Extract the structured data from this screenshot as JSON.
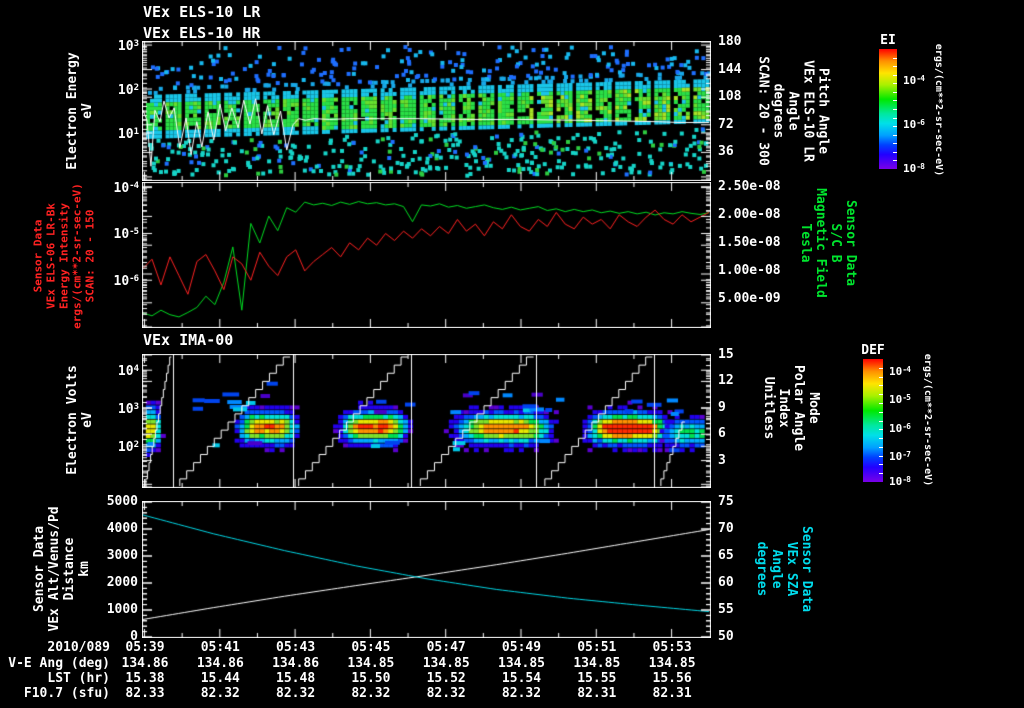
{
  "header": {
    "title_line1": "VEx ELS-10 LR",
    "title_line2": "VEx ELS-10 HR"
  },
  "colors": {
    "background": "#000000",
    "axis": "#ffffff",
    "red_series": "#ff2222",
    "green_series": "#00dd22",
    "cyan_series": "#00d9e8",
    "white_series": "#ffffff",
    "red_label": "#ff2222",
    "green_label": "#00e52e",
    "cyan_label": "#00dcec"
  },
  "chart_data": [
    {
      "type": "heatmap",
      "id": "els_pitch_angle_spectrogram",
      "left_label": "Electron Energy\neV",
      "right_label": "Pitch Angle\nVEx ELS-10 LR\nAngle\ndegrees\nSCAN: 20 - 300",
      "yaxis": {
        "scale": "log",
        "ticks": [
          "10^3",
          "10^2",
          "10^1"
        ],
        "tick_exps": [
          3,
          2,
          1
        ],
        "exp_top": 3.07,
        "exp_bottom": -0.07
      },
      "y2axis": {
        "min": 0,
        "max": 180,
        "ticks": [
          180,
          144,
          108,
          72,
          36
        ],
        "minor_step": 6
      },
      "band": {
        "logE_top_left": 1.86,
        "logE_top_right": 2.25,
        "logE_bottom_left": 0.95,
        "logE_bottom_right": 1.25
      },
      "pitch_line_deg": [
        [
          0,
          91
        ],
        [
          0.007,
          78
        ],
        [
          0.014,
          18
        ],
        [
          0.021,
          91
        ],
        [
          0.03,
          76
        ],
        [
          0.037,
          103
        ],
        [
          0.046,
          81
        ],
        [
          0.055,
          94
        ],
        [
          0.065,
          42
        ],
        [
          0.076,
          81
        ],
        [
          0.085,
          33
        ],
        [
          0.095,
          76
        ],
        [
          0.104,
          43
        ],
        [
          0.115,
          89
        ],
        [
          0.125,
          52
        ],
        [
          0.136,
          99
        ],
        [
          0.146,
          64
        ],
        [
          0.157,
          94
        ],
        [
          0.168,
          68
        ],
        [
          0.178,
          104
        ],
        [
          0.189,
          73
        ],
        [
          0.199,
          106
        ],
        [
          0.21,
          60
        ],
        [
          0.22,
          97
        ],
        [
          0.231,
          59
        ],
        [
          0.243,
          90
        ],
        [
          0.254,
          39
        ],
        [
          0.265,
          72
        ],
        [
          0.275,
          80
        ],
        [
          0.287,
          78
        ],
        [
          0.302,
          80
        ],
        [
          0.33,
          79
        ],
        [
          0.365,
          80
        ],
        [
          0.418,
          80
        ],
        [
          0.488,
          80
        ],
        [
          0.577,
          79
        ],
        [
          0.665,
          79
        ],
        [
          0.753,
          78
        ],
        [
          0.841,
          77
        ],
        [
          0.912,
          76
        ],
        [
          0.947,
          75
        ],
        [
          1,
          75
        ]
      ],
      "scatter": {
        "seed": 7,
        "n_above_band": 240,
        "n_below_band": 430,
        "n_blocks": 29
      }
    },
    {
      "type": "line",
      "id": "energy_intensity_and_bfield",
      "left_label": "Sensor Data\nVEx ELS-06 LR-Bk\nEnergy Intensity\nergs/(cm**2-sr-sec-eV)\nSCAN: 20 - 150",
      "right_label": "Sensor Data\nS/C B\nMagnetic Field\nTesla",
      "yaxis": {
        "scale": "log",
        "ticks": [
          "10^-4",
          "10^-5",
          "10^-6"
        ],
        "tick_exps": [
          -4,
          -5,
          -6
        ],
        "exp_top": -3.92,
        "exp_bottom": -7.0
      },
      "y2axis": {
        "min": 0,
        "max": 2.5e-08,
        "ticks": [
          "2.50e-08",
          "2.00e-08",
          "1.50e-08",
          "1.00e-08",
          "5.00e-09"
        ],
        "tick_values_nT": [
          25,
          20,
          15,
          10,
          5
        ]
      },
      "series": [
        {
          "name": "ELS energy intensity",
          "color": "#ff2222",
          "units": "log10 ergs/(cm**2-sr-sec-eV)",
          "values_log10": [
            -5.75,
            -5.55,
            -6.1,
            -5.5,
            -5.9,
            -6.3,
            -5.6,
            -5.45,
            -5.8,
            -6.2,
            -5.5,
            -5.65,
            -6.0,
            -5.4,
            -5.7,
            -5.9,
            -5.5,
            -5.35,
            -5.8,
            -5.6,
            -5.45,
            -5.3,
            -5.5,
            -5.2,
            -5.35,
            -5.1,
            -5.25,
            -5.0,
            -5.15,
            -4.95,
            -5.1,
            -4.9,
            -5.05,
            -4.85,
            -5.0,
            -4.7,
            -4.95,
            -4.8,
            -5.05,
            -4.75,
            -4.9,
            -4.6,
            -4.85,
            -4.95,
            -4.7,
            -4.85,
            -4.55,
            -4.8,
            -4.9,
            -4.65,
            -4.8,
            -4.7,
            -4.9,
            -4.6,
            -4.75,
            -4.85,
            -4.65,
            -4.5,
            -4.7,
            -4.8,
            -4.6,
            -4.75,
            -4.65,
            -4.55
          ]
        },
        {
          "name": "S/C B magnetic field",
          "color": "#00dd22",
          "units": "nT",
          "values_nT": [
            2.5,
            2.0,
            3.0,
            2.2,
            1.8,
            2.6,
            3.5,
            5.5,
            4.0,
            8.0,
            14.3,
            3.0,
            18.5,
            15.0,
            19.8,
            17.2,
            21.3,
            20.5,
            22.3,
            21.8,
            22.1,
            21.7,
            22.3,
            21.9,
            22.4,
            22.0,
            22.2,
            21.8,
            22.0,
            21.5,
            18.8,
            21.8,
            21.6,
            22.0,
            21.4,
            21.7,
            21.2,
            21.5,
            21.8,
            21.3,
            21.0,
            21.4,
            20.9,
            21.2,
            21.5,
            20.8,
            21.1,
            20.6,
            21.0,
            20.6,
            20.9,
            20.4,
            20.7,
            20.3,
            20.6,
            20.2,
            20.5,
            20.0,
            20.4,
            20.2,
            20.6,
            20.3,
            20.1,
            20.4
          ]
        }
      ]
    },
    {
      "type": "heatmap",
      "id": "ima_polar_angle_spectrogram",
      "title": "VEx IMA-00",
      "left_label": "Electron Volts\neV",
      "right_label": "Mode\nPolar Angle\nIndex\nUnitless",
      "yaxis": {
        "scale": "log",
        "ticks": [
          "10^4",
          "10^3",
          "10^2"
        ],
        "tick_exps": [
          4,
          3,
          2
        ],
        "exp_top": 4.4,
        "exp_bottom": 0.93
      },
      "y2axis": {
        "min": 0,
        "max": 15,
        "ticks": [
          15,
          12,
          9,
          6,
          3
        ],
        "minor_step": 0.6
      },
      "polar_index_sweeps": [
        [
          0.005,
          0.05,
          1
        ],
        [
          0.065,
          0.26,
          1
        ],
        [
          0.275,
          0.468,
          1
        ],
        [
          0.49,
          0.69,
          1
        ],
        [
          0.71,
          0.9,
          1
        ],
        [
          0.915,
          1.0,
          0.55
        ]
      ],
      "sweep_boundaries": [
        0.053,
        0.265,
        0.474,
        0.695,
        0.903
      ],
      "blobs": [
        {
          "x": 0.004,
          "logE": 2.5,
          "sx": 0.02,
          "slog": 0.45,
          "amp": 0.8
        },
        {
          "x": 0.217,
          "logE": 2.55,
          "sx": 0.045,
          "slog": 0.36,
          "amp": 0.88
        },
        {
          "x": 0.404,
          "logE": 2.55,
          "sx": 0.05,
          "slog": 0.36,
          "amp": 0.92
        },
        {
          "x": 0.634,
          "logE": 2.52,
          "sx": 0.07,
          "slog": 0.34,
          "amp": 0.9
        },
        {
          "x": 0.853,
          "logE": 2.52,
          "sx": 0.06,
          "slog": 0.34,
          "amp": 1.08
        },
        {
          "x": 0.968,
          "logE": 2.4,
          "sx": 0.045,
          "slog": 0.32,
          "amp": 0.52
        }
      ],
      "scatter": {
        "seed": 11,
        "n_dashes": 38
      }
    },
    {
      "type": "line",
      "id": "altitude_and_sza",
      "left_label": "Sensor Data\nVEx Alt/Venus/Pd\nDistance\nkm",
      "right_label": "Sensor Data\nVEx SZA\nAngle\ndegrees",
      "yaxis": {
        "min": 0,
        "max": 5000,
        "ticks": [
          5000,
          4000,
          3000,
          2000,
          1000,
          0
        ],
        "minor_step": 200
      },
      "y2axis": {
        "min": 50,
        "max": 75,
        "ticks": [
          75,
          70,
          65,
          60,
          55,
          50
        ],
        "minor_step": 1
      },
      "series": [
        {
          "name": "VEx altitude",
          "color": "#ffffff",
          "units": "km",
          "points": [
            [
              0,
              650
            ],
            [
              0.125,
              1090
            ],
            [
              0.25,
              1510
            ],
            [
              0.375,
              1900
            ],
            [
              0.5,
              2280
            ],
            [
              0.625,
              2680
            ],
            [
              0.75,
              3100
            ],
            [
              0.875,
              3540
            ],
            [
              1,
              3980
            ]
          ]
        },
        {
          "name": "VEx SZA",
          "color": "#00d9e8",
          "units": "degrees",
          "points": [
            [
              0,
              72.6
            ],
            [
              0.125,
              69.1
            ],
            [
              0.25,
              66.0
            ],
            [
              0.375,
              63.2
            ],
            [
              0.5,
              60.8
            ],
            [
              0.625,
              58.8
            ],
            [
              0.75,
              57.2
            ],
            [
              0.875,
              55.9
            ],
            [
              1,
              54.7
            ]
          ]
        }
      ]
    }
  ],
  "colorbars": [
    {
      "title": "EI",
      "tick_labels": [
        "10^-4",
        "10^-6",
        "10^-8"
      ],
      "tick_fracs": [
        0.25,
        0.62,
        0.985
      ],
      "units": "ergs/(cm**2-sr-sec-eV)"
    },
    {
      "title": "DEF",
      "tick_labels": [
        "10^-4",
        "10^-5",
        "10^-6",
        "10^-7",
        "10^-8"
      ],
      "tick_fracs": [
        0.09,
        0.32,
        0.55,
        0.78,
        0.985
      ],
      "units": "ergs/(cm**2-sr-sec-eV)"
    }
  ],
  "time_axis": {
    "labels": [
      "05:39",
      "05:41",
      "05:43",
      "05:45",
      "05:47",
      "05:49",
      "05:51",
      "05:53"
    ]
  },
  "table": {
    "date": "2010/089",
    "rows": [
      {
        "label": "V-E Ang (deg)",
        "values": [
          "134.86",
          "134.86",
          "134.86",
          "134.85",
          "134.85",
          "134.85",
          "134.85",
          "134.85"
        ]
      },
      {
        "label": "LST (hr)",
        "values": [
          "15.38",
          "15.44",
          "15.48",
          "15.50",
          "15.52",
          "15.54",
          "15.55",
          "15.56"
        ]
      },
      {
        "label": "F10.7 (sfu)",
        "values": [
          "82.33",
          "82.32",
          "82.32",
          "82.32",
          "82.32",
          "82.32",
          "82.31",
          "82.31"
        ]
      }
    ]
  }
}
